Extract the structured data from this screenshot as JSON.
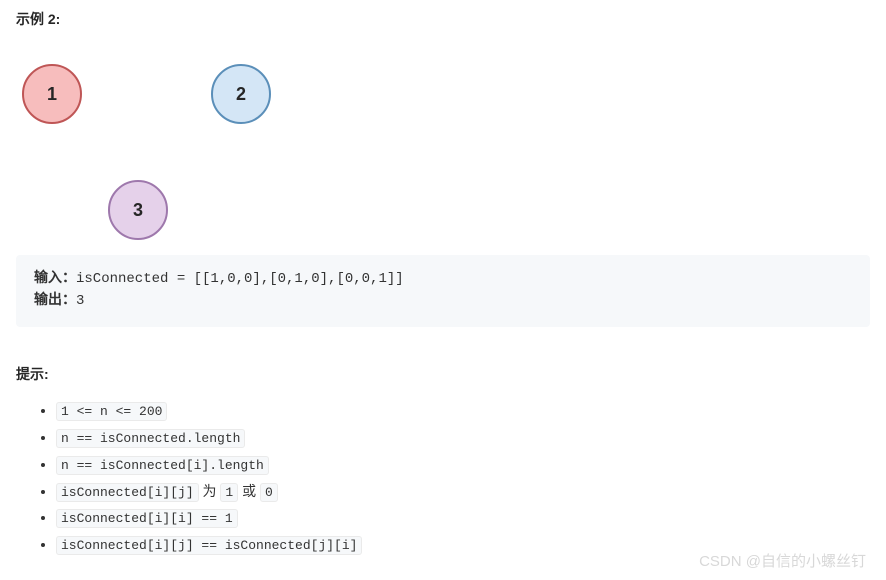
{
  "example": {
    "heading": "示例 2:",
    "nodes": {
      "n1": "1",
      "n2": "2",
      "n3": "3"
    },
    "input_label": "输入：",
    "input_value": "isConnected = [[1,0,0],[0,1,0],[0,0,1]]",
    "output_label": "输出：",
    "output_value": "3"
  },
  "hints_heading": "提示:",
  "hints": {
    "h0": "1 <= n <= 200",
    "h1": "n == isConnected.length",
    "h2": "n == isConnected[i].length",
    "h3_a": "isConnected[i][j]",
    "h3_mid": " 为 ",
    "h3_b": "1",
    "h3_or": " 或 ",
    "h3_c": "0",
    "h4": "isConnected[i][i] == 1",
    "h5": "isConnected[i][j] == isConnected[j][i]"
  },
  "watermark": "CSDN @自信的小螺丝钉"
}
